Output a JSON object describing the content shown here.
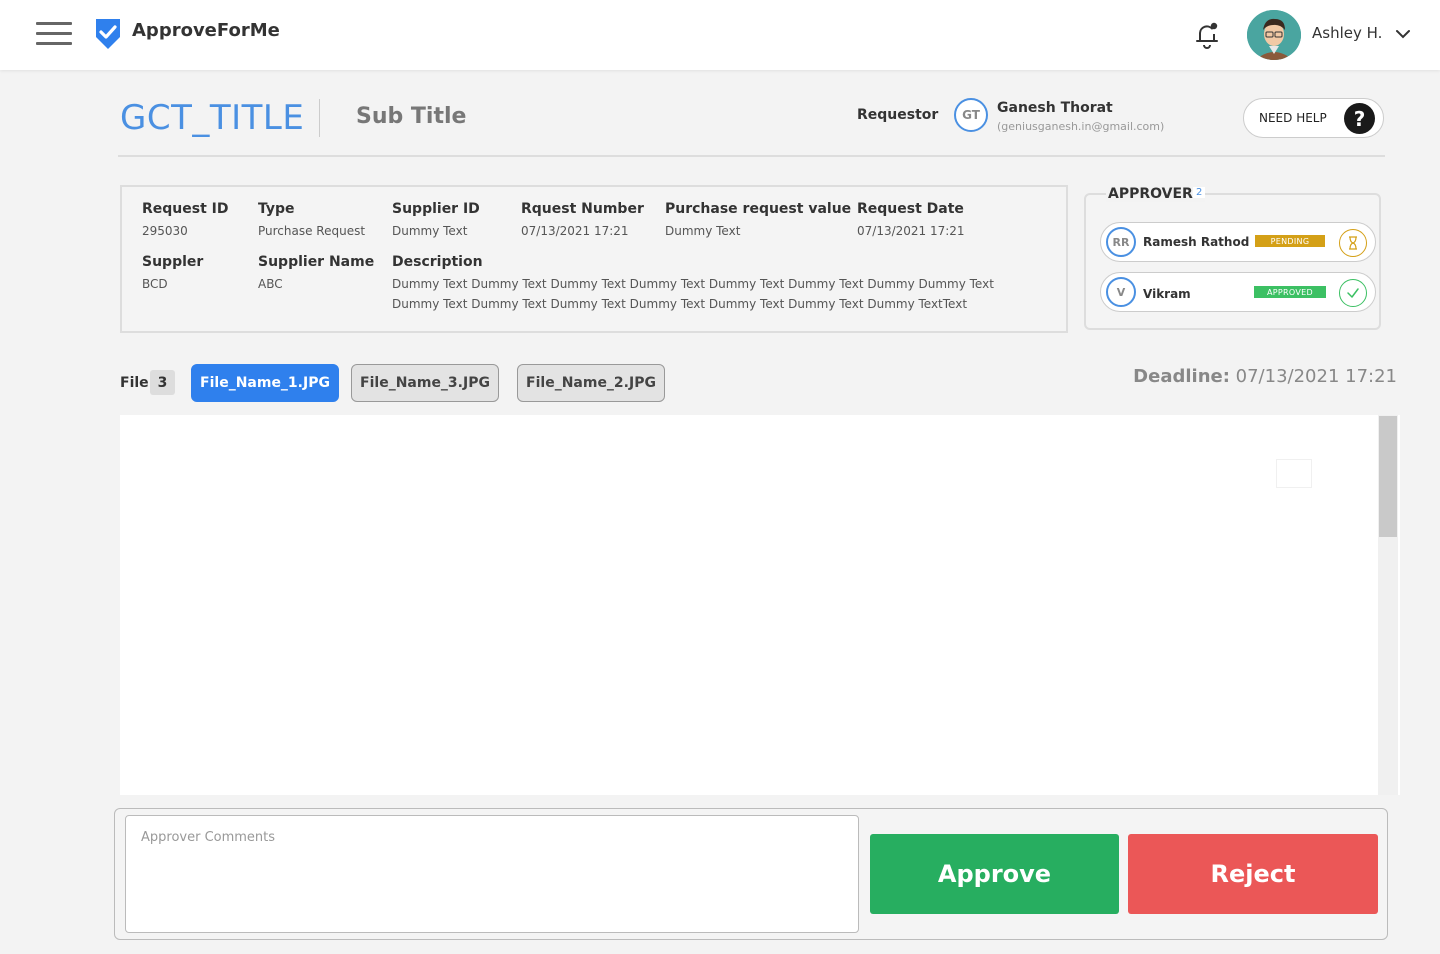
{
  "app": {
    "brand": "ApproveForMe"
  },
  "user": {
    "name": "Ashley H."
  },
  "header": {
    "title": "GCT_TITLE",
    "subtitle": "Sub Title",
    "requestor_label": "Requestor",
    "requestor_initials": "GT",
    "requestor_name": "Ganesh Thorat",
    "requestor_email": "(geniusganesh.in@gmail.com)",
    "help_label": "NEED HELP",
    "help_icon": "?"
  },
  "details": {
    "request_id": {
      "label": "Request ID",
      "value": "295030"
    },
    "type": {
      "label": "Type",
      "value": "Purchase Request"
    },
    "supplier_id": {
      "label": "Supplier ID",
      "value": "Dummy Text"
    },
    "request_number": {
      "label": "Rquest Number",
      "value": "07/13/2021 17:21"
    },
    "purchase_value": {
      "label": "Purchase request value",
      "value": "Dummy Text"
    },
    "request_date": {
      "label": "Request Date",
      "value": "07/13/2021 17:21"
    },
    "supplier": {
      "label": "Suppler",
      "value": "BCD"
    },
    "supplier_name": {
      "label": "Supplier Name",
      "value": "ABC"
    },
    "description": {
      "label": "Description",
      "value": "Dummy Text Dummy Text Dummy Text Dummy Text Dummy Text Dummy Text Dummy Dummy Text Dummy Text Dummy Text Dummy Text Dummy Text Dummy Text Dummy Text Dummy TextText"
    }
  },
  "approvers": {
    "title": "APPROVERS",
    "count": "2",
    "items": [
      {
        "initials": "RR",
        "name": "Ramesh Rathod",
        "status": "PENDING",
        "status_color": "#d4a017",
        "icon": "hourglass-icon"
      },
      {
        "initials": "V",
        "name": "Vikram",
        "status": "APPROVED",
        "status_color": "#3cc063",
        "icon": "check-circle-icon"
      }
    ]
  },
  "files": {
    "label": "File",
    "count": "3",
    "tabs": [
      {
        "name": "File_Name_1.JPG",
        "active": true
      },
      {
        "name": "File_Name_3.JPG",
        "active": false
      },
      {
        "name": "File_Name_2.JPG",
        "active": false
      }
    ],
    "deadline_label": "Deadline:",
    "deadline_value": "07/13/2021 17:21"
  },
  "footer": {
    "comments_placeholder": "Approver Comments",
    "approve_label": "Approve",
    "reject_label": "Reject"
  },
  "colors": {
    "accent": "#2f80ed",
    "approve": "#27ae60",
    "reject": "#eb5757",
    "pending": "#d4a017",
    "approved": "#3cc063"
  }
}
